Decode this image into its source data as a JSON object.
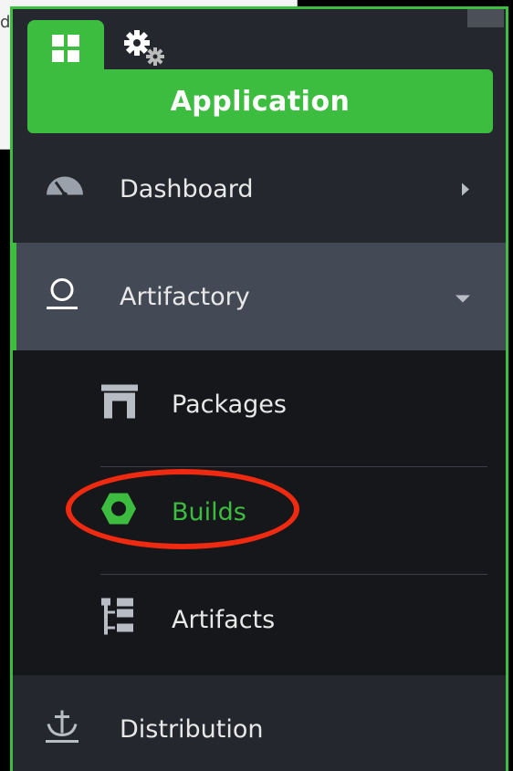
{
  "background_page": {
    "partial_text": "d"
  },
  "tabs": [
    {
      "name": "applications",
      "icon": "grid-icon",
      "active": true
    },
    {
      "name": "settings",
      "icon": "gears-icon",
      "active": false
    }
  ],
  "header": {
    "title": "Application"
  },
  "menu": {
    "dashboard": {
      "label": "Dashboard",
      "icon": "speedometer-icon"
    },
    "artifactory": {
      "label": "Artifactory",
      "icon": "artifactory-icon",
      "expanded": true
    },
    "submenu": [
      {
        "label": "Packages",
        "icon": "packages-icon"
      },
      {
        "label": "Builds",
        "icon": "hexagon-icon",
        "active": true
      },
      {
        "label": "Artifacts",
        "icon": "tree-icon"
      }
    ],
    "distribution": {
      "label": "Distribution",
      "icon": "anchor-icon"
    }
  },
  "colors": {
    "accent_green": "#3dbd3f",
    "panel_bg": "#24272e",
    "selected_bg": "#444a55",
    "submenu_bg": "#15171b",
    "annotation_red": "#f02a10"
  }
}
